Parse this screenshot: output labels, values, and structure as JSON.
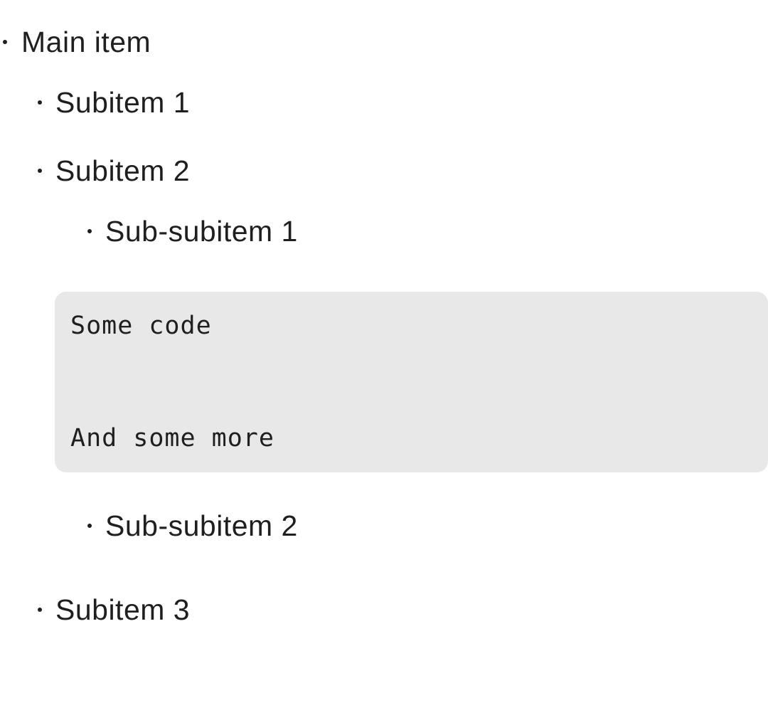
{
  "list": {
    "main_item": "Main item",
    "subitem_1": "Subitem 1",
    "subitem_2": "Subitem 2",
    "sub_subitem_1": "Sub-subitem 1",
    "sub_subitem_2": "Sub-subitem 2",
    "subitem_3": "Subitem 3"
  },
  "code": {
    "line_1": "Some code",
    "line_2": "And some more"
  },
  "colors": {
    "text": "#1f1f1f",
    "code_background": "#e8e8e8",
    "page_background": "#ffffff"
  }
}
